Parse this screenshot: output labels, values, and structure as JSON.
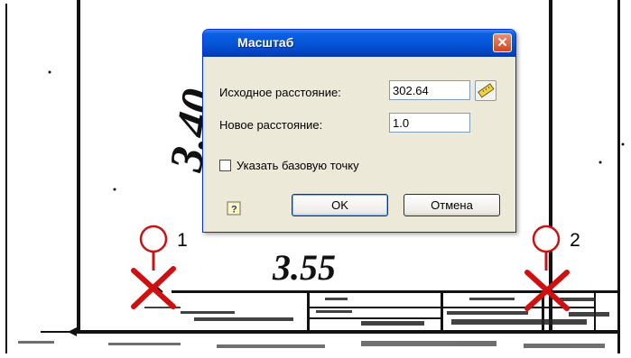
{
  "dialog": {
    "title": "Масштаб",
    "source_label": "Исходное расстояние:",
    "source_value": "302.64",
    "new_label": "Новое расстояние:",
    "new_value": "1.0",
    "checkbox_label": "Указать базовую точку",
    "checkbox_checked": false,
    "ok_label": "OK",
    "cancel_label": "Отмена"
  },
  "drawing": {
    "dimension_vertical": "3.40",
    "dimension_horizontal": "3.55"
  },
  "markers": [
    {
      "number": "1"
    },
    {
      "number": "2"
    }
  ],
  "colors": {
    "title_bar": "#0656d8",
    "close_button": "#d0451f",
    "marker_x": "#d01010",
    "dialog_bg": "#ece9d8"
  }
}
